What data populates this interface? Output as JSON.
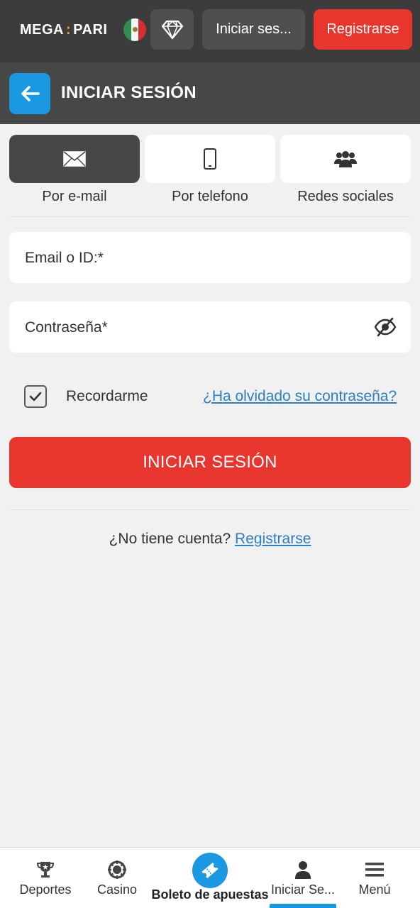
{
  "topbar": {
    "logo_left": "MEGA",
    "logo_sep": ":",
    "logo_right": "PARI",
    "login_label": "Iniciar ses...",
    "register_label": "Registrarse"
  },
  "header": {
    "title": "INICIAR SESIÓN"
  },
  "tabs": [
    {
      "label": "Por e-mail",
      "icon": "envelope-icon",
      "active": true
    },
    {
      "label": "Por telefono",
      "icon": "phone-icon",
      "active": false
    },
    {
      "label": "Redes sociales",
      "icon": "users-icon",
      "active": false
    }
  ],
  "form": {
    "email_label": "Email o ID:*",
    "password_label": "Contraseña*",
    "remember_label": "Recordarme",
    "remember_checked": true,
    "forgot_label": "¿Ha olvidado su contraseña?",
    "submit_label": "INICIAR SESIÓN",
    "no_account_text": "¿No tiene cuenta?",
    "register_link": "Registrarse"
  },
  "bottom_nav": {
    "items": [
      {
        "label": "Deportes",
        "icon": "trophy-icon"
      },
      {
        "label": "Casino",
        "icon": "casino-chip-icon"
      },
      {
        "label": "Boleto de apuestas",
        "icon": "ticket-icon"
      },
      {
        "label": "Iniciar Se...",
        "icon": "person-icon",
        "active": true
      },
      {
        "label": "Menú",
        "icon": "menu-icon"
      }
    ]
  },
  "colors": {
    "accent_red": "#e8352e",
    "accent_blue": "#1a98e2",
    "dark_bar": "#3c3c3c",
    "link": "#2d7fc1"
  }
}
